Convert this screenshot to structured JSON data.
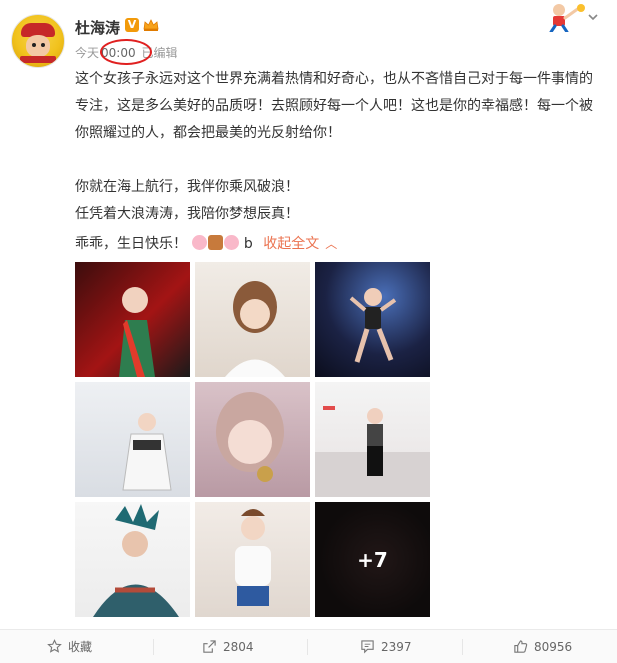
{
  "post": {
    "username": "杜海涛",
    "meta": {
      "day": "今天",
      "time": "00:00",
      "edited": "已编辑"
    },
    "paragraphs": [
      "这个女孩子永远对这个世界充满着热情和好奇心，也从不吝惜自己对于每一件事情的专注，这是多么美好的品质呀！去照顾好每一个人吧！这也是你的幸福感！每一个被你照耀过的人，都会把最美的光反射给你！",
      "你就在海上航行，我伴你乘风破浪！",
      "任凭着大浪涛涛，我陪你梦想辰真！"
    ],
    "birthday": {
      "text": "乖乖，生日快乐！",
      "trailing": "b",
      "fold_label": "收起全文"
    },
    "more_photos": "+7"
  },
  "actions": {
    "favorite": "收藏",
    "repost": "2804",
    "comment": "2397",
    "like": "80956"
  },
  "colors": {
    "accent": "#eb7350",
    "highlight_ring": "#e02020",
    "vip_badge": "#f29a0a"
  }
}
